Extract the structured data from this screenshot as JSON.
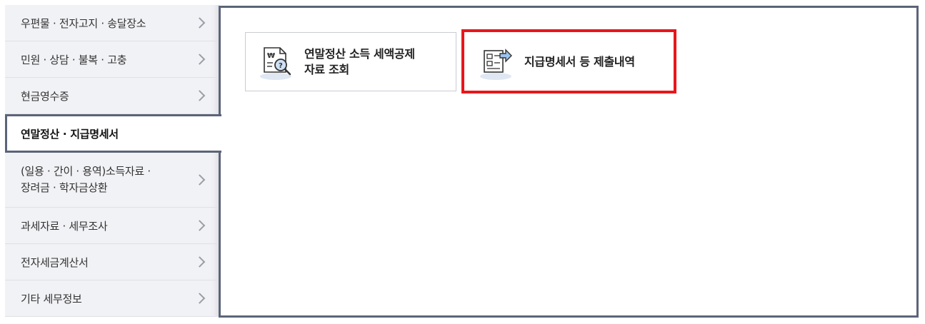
{
  "sidebar": {
    "items": [
      {
        "lines": [
          "우편물 · 전자고지 · 송달장소"
        ]
      },
      {
        "lines": [
          "민원 · 상담 · 불복 · 고충"
        ]
      },
      {
        "lines": [
          "현금영수증"
        ]
      },
      {
        "lines": [
          "연말정산 · 지급명세서"
        ],
        "active": true
      },
      {
        "lines": [
          "(일용 · 간이 · 용역)소득자료 ·",
          "장려금 · 학자금상환"
        ]
      },
      {
        "lines": [
          "과세자료 · 세무조사"
        ]
      },
      {
        "lines": [
          "전자세금계산서"
        ]
      },
      {
        "lines": [
          "기타 세무정보"
        ]
      }
    ]
  },
  "cards": [
    {
      "lines": [
        "연말정산 소득 세액공제",
        "자료 조회"
      ],
      "icon": "won-document-magnifier-icon"
    },
    {
      "lines": [
        "지급명세서 등 제출내역"
      ],
      "icon": "document-arrow-icon",
      "highlighted": true
    }
  ],
  "colors": {
    "active_border": "#5b6478",
    "highlight": "#e8161b",
    "sidebar_bg": "#f1f2f5"
  }
}
